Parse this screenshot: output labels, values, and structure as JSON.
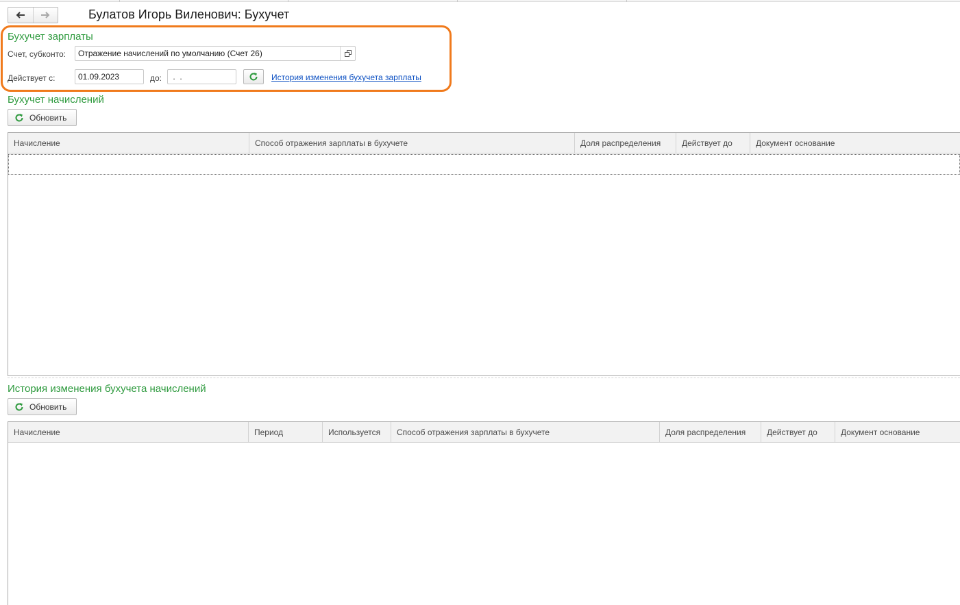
{
  "window": {
    "title": "Булатов Игорь Виленович: Бухучет",
    "nav": {
      "back_icon": "arrow-left-icon",
      "forward_icon": "arrow-right-icon"
    }
  },
  "salary_accounting": {
    "title": "Бухучет зарплаты",
    "account_label": "Счет, субконто:",
    "account_value": "Отражение начислений по умолчанию (Счет 26)",
    "valid_from_label": "Действует с:",
    "valid_from_value": "01.09.2023",
    "valid_to_label": "до:",
    "valid_to_value": " .  .",
    "history_link": "История изменения бухучета зарплаты"
  },
  "accruals_accounting": {
    "title": "Бухучет начислений",
    "refresh_label": "Обновить",
    "columns": [
      "Начисление",
      "Способ отражения зарплаты в бухучете",
      "Доля распределения",
      "Действует до",
      "Документ основание"
    ],
    "rows": []
  },
  "accruals_history": {
    "title": "История изменения бухучета начислений",
    "refresh_label": "Обновить",
    "columns": [
      "Начисление",
      "Период",
      "Используется",
      "Способ отражения зарплаты в бухучете",
      "Доля распределения",
      "Действует до",
      "Документ основание"
    ],
    "rows": []
  },
  "colors": {
    "section_title": "#2e9a3e",
    "highlight": "#f07a1c",
    "link": "#0b4fc2",
    "refresh_icon": "#2e9a3e"
  }
}
